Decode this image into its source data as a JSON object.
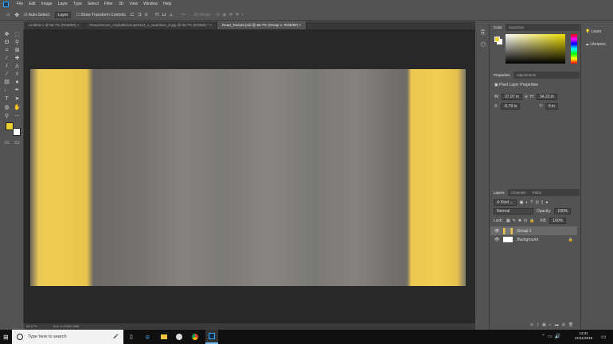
{
  "menu": [
    "File",
    "Edit",
    "Image",
    "Layer",
    "Type",
    "Select",
    "Filter",
    "3D",
    "View",
    "Window",
    "Help"
  ],
  "options": {
    "auto_select": "Auto-Select:",
    "layer": "Layer",
    "show_transform": "Show Transform Controls",
    "mode3d": "3D Mode:"
  },
  "tabs": [
    "Untitled-1 @ 66.7% (RGB/8#)",
    "TexturesCom_AsphaltClosups0113_1_seamless_S.jpg @ 66.7% (RGB/8) *",
    "Road_Texture.psd @ 66.7% (Group 1, RGB/8#)"
  ],
  "status": {
    "zoom": "66.67%",
    "doc": "Doc: 6.00M/9.68M"
  },
  "color_panel": {
    "tabs": [
      "Color",
      "Swatches"
    ],
    "foreground": "#e9cf2f",
    "background": "#ffffff"
  },
  "properties": {
    "tabs": [
      "Properties",
      "Adjustments"
    ],
    "title": "Pixel Layer Properties",
    "w_label": "W:",
    "w": "37.97 in",
    "h_label": "H:",
    "h": "34.23 in",
    "x_label": "X:",
    "x": "-6.79 in",
    "y_label": "Y:",
    "y": "0 in"
  },
  "layers": {
    "tabs": [
      "Layers",
      "Channels",
      "Paths"
    ],
    "filter": "Kind",
    "blend": "Normal",
    "opacity_label": "Opacity:",
    "opacity": "100%",
    "lock_label": "Lock:",
    "fill_label": "Fill:",
    "fill": "100%",
    "items": [
      {
        "name": "Group 1"
      },
      {
        "name": "Background"
      }
    ]
  },
  "right": {
    "learn": "Learn",
    "libraries": "Libraries"
  },
  "taskbar": {
    "search": "Type here to search",
    "time": "13:41",
    "date": "21/11/2019"
  }
}
